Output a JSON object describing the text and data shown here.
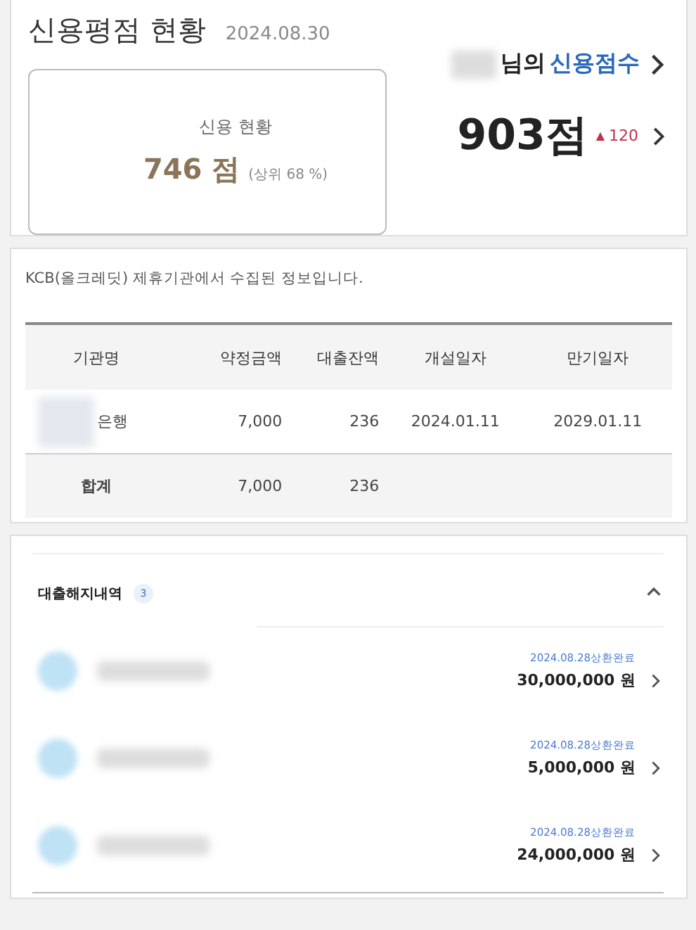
{
  "credit_summary": {
    "title": "신용평점 현황",
    "date": "2024.08.30",
    "status_label": "신용 현황",
    "score": "746 점",
    "percentile": "(상위 68 %)",
    "name_suffix": "님의",
    "link": "신용점수",
    "big_score": "903점",
    "change_arrow": "▲",
    "change": "120"
  },
  "loan_table": {
    "notice": "KCB(올크레딧) 제휴기관에서 수집된 정보입니다.",
    "columns": [
      "기관명",
      "약정금액",
      "대출잔액",
      "개설일자",
      "만기일자"
    ],
    "rows": [
      {
        "kind": "item",
        "cells": [
          "은행",
          "7,000",
          "236",
          "2024.01.11",
          "2029.01.11"
        ]
      },
      {
        "kind": "total",
        "cells": [
          "합계",
          "7,000",
          "236"
        ]
      }
    ]
  },
  "closed_loans": {
    "title": "대출해지내역",
    "count": "3",
    "expanded": true,
    "items": [
      {
        "status": "2024.08.28상환완료",
        "amount": "30,000,000 원"
      },
      {
        "status": "2024.08.28상환완료",
        "amount": "5,000,000 원"
      },
      {
        "status": "2024.08.28상환완료",
        "amount": "24,000,000 원"
      }
    ]
  }
}
